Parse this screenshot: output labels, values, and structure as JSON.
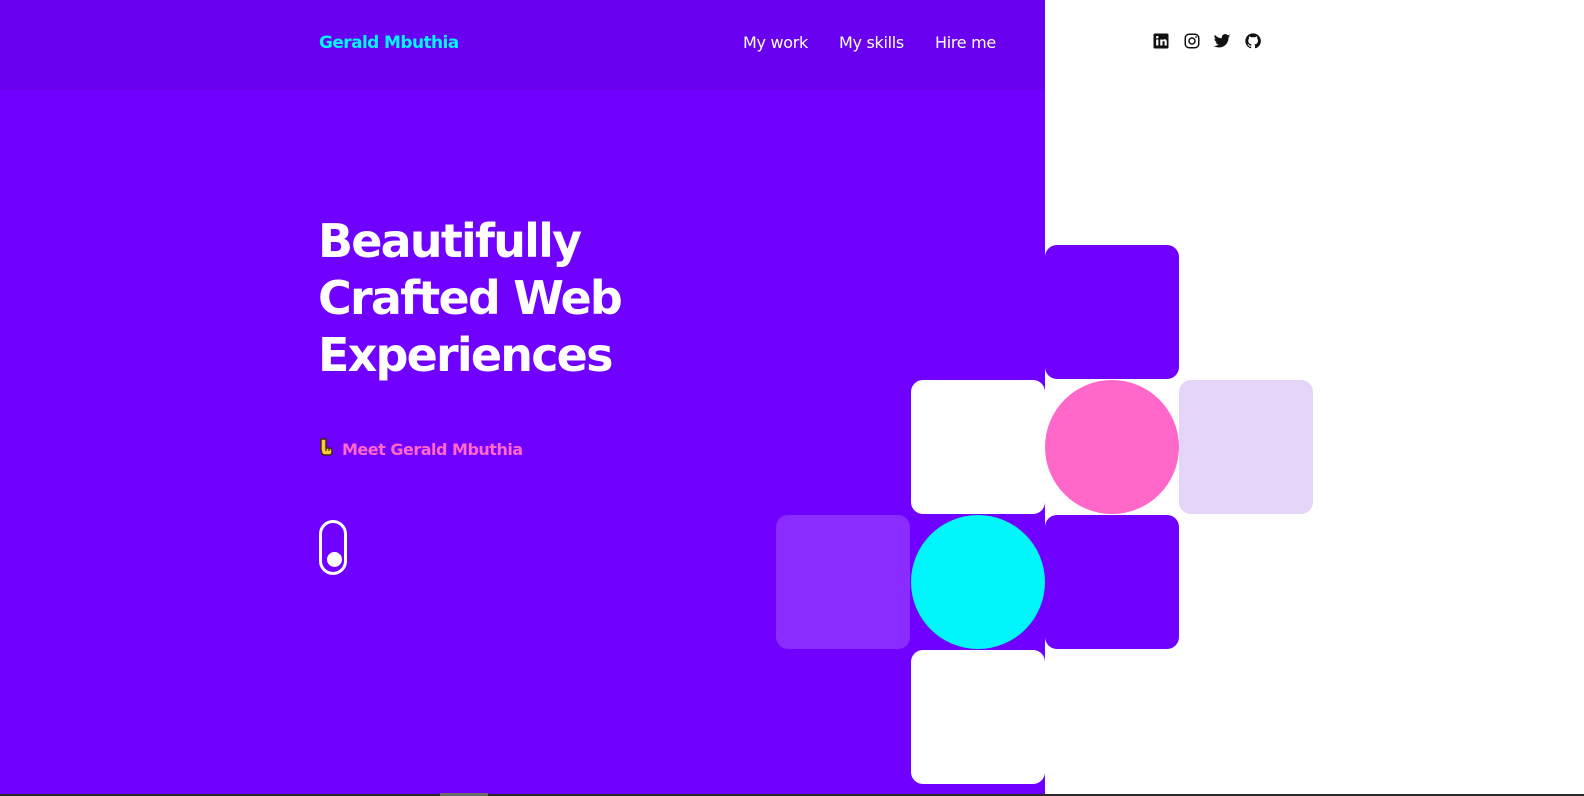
{
  "header": {
    "logo": "Gerald Mbuthia",
    "nav": [
      {
        "label": "My work"
      },
      {
        "label": "My skills"
      },
      {
        "label": "Hire me"
      }
    ],
    "social": [
      {
        "icon": "linkedin-icon"
      },
      {
        "icon": "instagram-icon"
      },
      {
        "icon": "twitter-icon"
      },
      {
        "icon": "github-icon"
      }
    ]
  },
  "hero": {
    "title_lines": [
      "Beautifully",
      "Crafted Web",
      "Experiences"
    ],
    "meet_icon": "pointing-hand-icon",
    "meet_text": "Meet Gerald Mbuthia",
    "scroll_icon": "scroll-mouse-icon"
  },
  "colors": {
    "primary": "#7000ff",
    "header_bg": "#6900ef",
    "logo": "#00f5ff",
    "accent_pink": "#ff67c8",
    "accent_cyan": "#00f6fb",
    "lavender": "#e4d5f8",
    "light_purple": "#8a2bff",
    "white": "#ffffff"
  }
}
